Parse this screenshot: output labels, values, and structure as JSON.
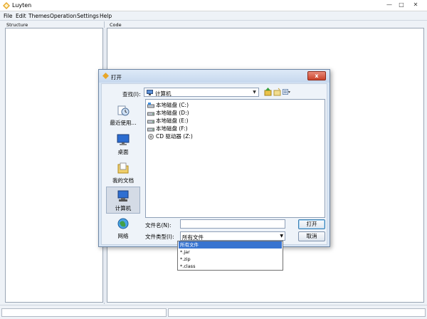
{
  "app": {
    "title": "Luyten",
    "icon": "luyten-app-icon",
    "window_controls": {
      "minimize": "—",
      "maximize": "□",
      "close": "✕"
    }
  },
  "menubar": {
    "items": [
      "File",
      "Edit",
      "Themes",
      "Operation",
      "Settings",
      "Help"
    ]
  },
  "panels": {
    "structure_label": "Structure",
    "code_label": "Code"
  },
  "dialog": {
    "title": "打开",
    "close_label": "x",
    "look_in_label": "查找(I):",
    "look_in_value": "计算机",
    "toolbar": {
      "up_icon": "up-folder-icon",
      "new_folder_icon": "new-folder-icon",
      "view_icon": "view-menu-icon"
    },
    "places": [
      {
        "label": "最近使用...",
        "icon": "recent-icon",
        "selected": false
      },
      {
        "label": "桌面",
        "icon": "desktop-icon",
        "selected": false
      },
      {
        "label": "我的文档",
        "icon": "documents-icon",
        "selected": false
      },
      {
        "label": "计算机",
        "icon": "computer-icon",
        "selected": true
      },
      {
        "label": "网络",
        "icon": "network-icon",
        "selected": false
      }
    ],
    "files": [
      {
        "name": "本地磁盘 (C:)",
        "icon": "system-drive-icon"
      },
      {
        "name": "本地磁盘 (D:)",
        "icon": "drive-icon"
      },
      {
        "name": "本地磁盘 (E:)",
        "icon": "drive-icon"
      },
      {
        "name": "本地磁盘 (F:)",
        "icon": "drive-icon"
      },
      {
        "name": "CD 驱动器 (Z:)",
        "icon": "cd-drive-icon"
      }
    ],
    "filename_label": "文件名(N):",
    "filename_value": "",
    "filetype_label": "文件类型(I):",
    "filetype_value": "所有文件",
    "open_button": "打开",
    "cancel_button": "取消",
    "filetype_options": [
      "所有文件",
      "*.jar",
      "*.zip",
      "*.class"
    ]
  },
  "colors": {
    "selection": "#3874d0",
    "dialog_bg": "#d9e6f5",
    "close_button": "#c9432b"
  }
}
